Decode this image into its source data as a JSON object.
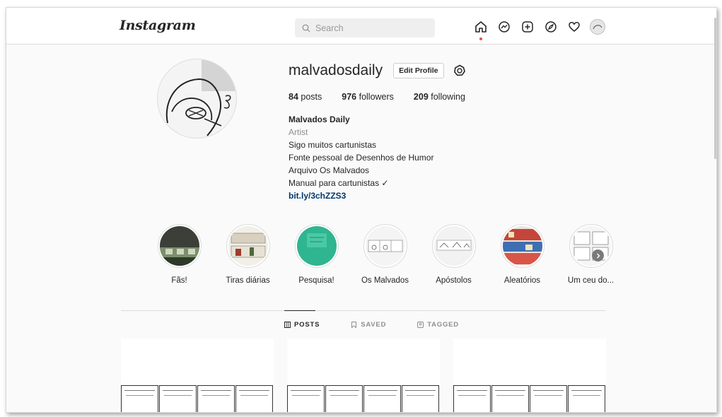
{
  "header": {
    "logo": "Instagram",
    "search_placeholder": "Search",
    "icons": [
      "home-icon",
      "messenger-icon",
      "new-post-icon",
      "explore-icon",
      "activity-heart-icon",
      "profile-avatar"
    ]
  },
  "profile": {
    "username": "malvadosdaily",
    "edit_label": "Edit Profile",
    "stats": [
      {
        "count": "84",
        "label": " posts"
      },
      {
        "count": "976",
        "label": " followers"
      },
      {
        "count": "209",
        "label": " following"
      }
    ],
    "bio": {
      "name": "Malvados Daily",
      "category": "Artist",
      "lines": [
        "Sigo muitos cartunistas",
        "Fonte pessoal de Desenhos de Humor",
        "Arquivo Os Malvados",
        "Manual para cartunistas ✓"
      ],
      "link": "bit.ly/3chZZS3"
    }
  },
  "highlights": [
    {
      "label": "Fãs!"
    },
    {
      "label": "Tiras diárias"
    },
    {
      "label": "Pesquisa!"
    },
    {
      "label": "Os Malvados"
    },
    {
      "label": "Apóstolos"
    },
    {
      "label": "Aleatórios"
    },
    {
      "label": "Um ceu do..."
    }
  ],
  "tabs": [
    {
      "label": "POSTS",
      "active": true
    },
    {
      "label": "SAVED",
      "active": false
    },
    {
      "label": "TAGGED",
      "active": false
    }
  ],
  "colors": {
    "accent_dot": "#ed4956",
    "link": "#00376b"
  }
}
